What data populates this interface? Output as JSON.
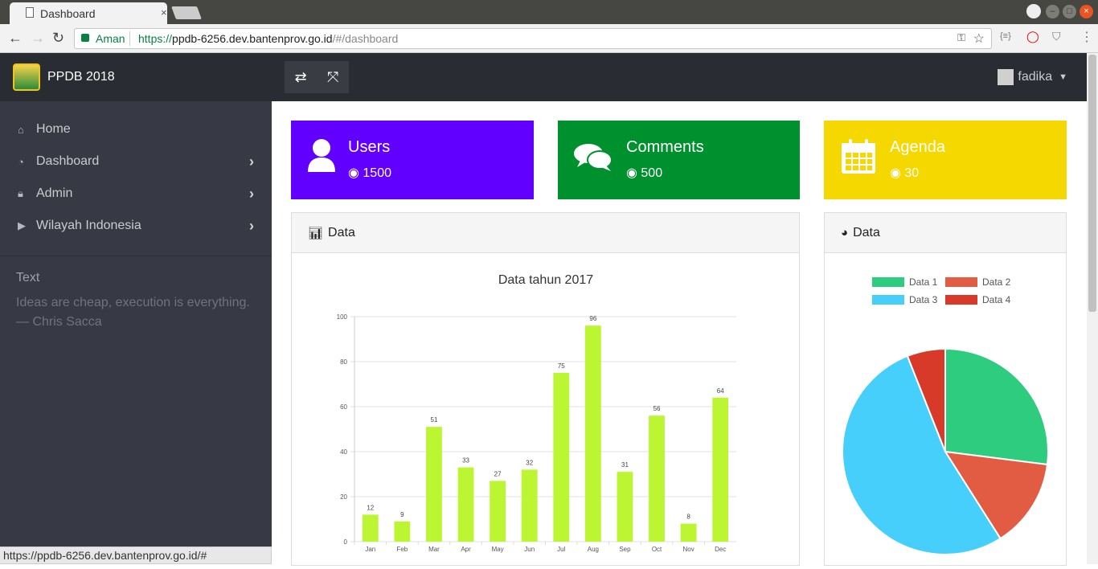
{
  "browser": {
    "tab_title": "Dashboard",
    "tab_close": "×",
    "secure_label": "Aman",
    "url_scheme": "https://",
    "url_host": "ppdb-6256.dev.bantenprov.go.id",
    "url_path": "/#/dashboard",
    "status_url": "https://ppdb-6256.dev.bantenprov.go.id/#"
  },
  "app": {
    "brand": "PPDB 2018",
    "user": "fadika"
  },
  "sidebar": {
    "items": [
      {
        "label": "Home",
        "icon": "home-icon",
        "has_children": false
      },
      {
        "label": "Dashboard",
        "icon": "dashboard-icon",
        "has_children": true
      },
      {
        "label": "Admin",
        "icon": "lock-icon",
        "has_children": true
      },
      {
        "label": "Wilayah Indonesia",
        "icon": "play-circle-icon",
        "has_children": true
      }
    ],
    "quote_heading": "Text",
    "quote_text": "Ideas are cheap, execution is everything.",
    "quote_author": "—  Chris Sacca"
  },
  "cards": [
    {
      "title": "Users",
      "value": "1500",
      "color": "#6200ff",
      "icon": "user-icon"
    },
    {
      "title": "Comments",
      "value": "500",
      "color": "#00912f",
      "icon": "comments-icon"
    },
    {
      "title": "Agenda",
      "value": "30",
      "color": "#f5d800",
      "icon": "calendar-icon"
    }
  ],
  "panels": {
    "bar_title": "Data",
    "pie_title": "Data"
  },
  "chart_data": [
    {
      "type": "bar",
      "title": "Data tahun 2017",
      "categories": [
        "Jan",
        "Feb",
        "Mar",
        "Apr",
        "May",
        "Jun",
        "Jul",
        "Aug",
        "Sep",
        "Oct",
        "Nov",
        "Dec"
      ],
      "values": [
        12,
        9,
        51,
        33,
        27,
        32,
        75,
        96,
        31,
        56,
        8,
        64
      ],
      "yticks": [
        0,
        20,
        40,
        60,
        80,
        100
      ],
      "ylim": [
        0,
        100
      ],
      "color": "#bcf531",
      "grid": true
    },
    {
      "type": "pie",
      "legend_position": "top",
      "series": [
        {
          "name": "Data 1",
          "value": 27,
          "color": "#2ecc7e"
        },
        {
          "name": "Data 2",
          "value": 14,
          "color": "#e25c43"
        },
        {
          "name": "Data 3",
          "value": 53,
          "color": "#47cffb"
        },
        {
          "name": "Data 4",
          "value": 6,
          "color": "#d83a2a"
        }
      ]
    }
  ]
}
